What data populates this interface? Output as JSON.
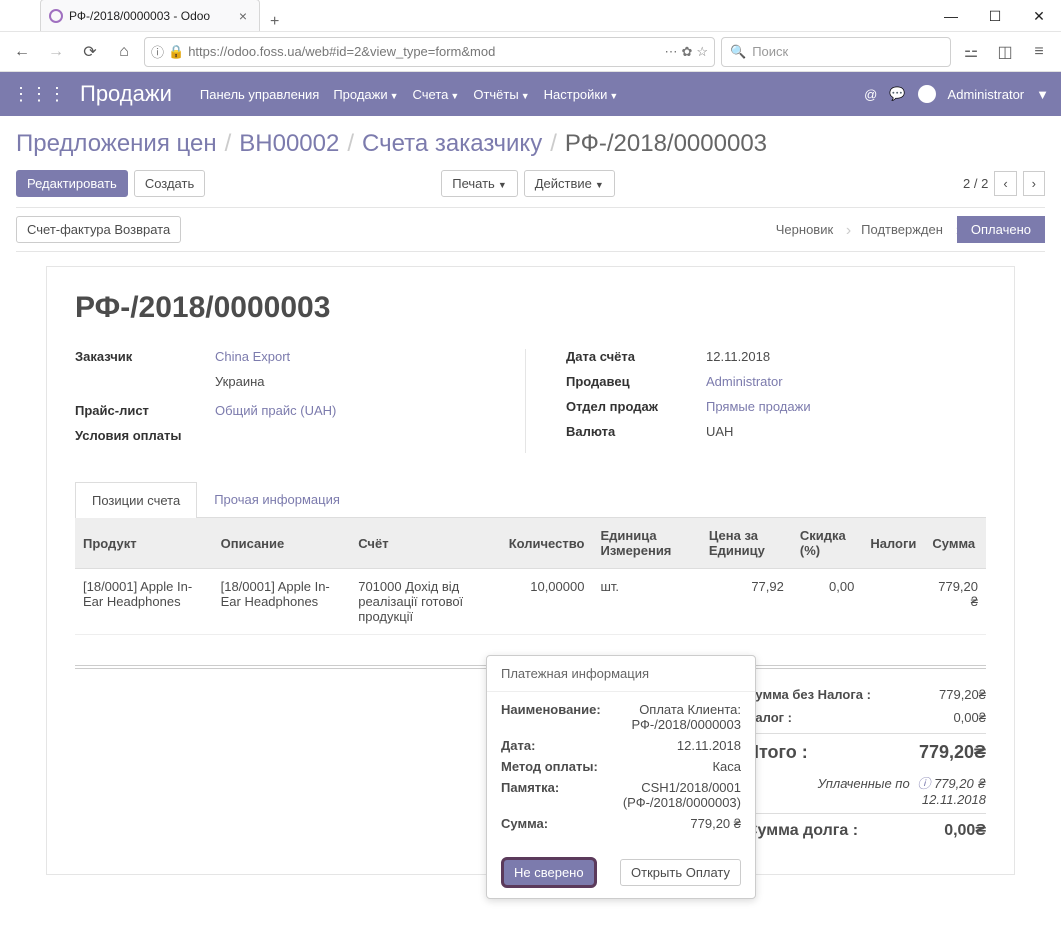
{
  "browser": {
    "tab_title": "РФ-/2018/0000003 - Odoo",
    "url": "https://odoo.foss.ua/web#id=2&view_type=form&mod",
    "search_placeholder": "Поиск"
  },
  "nav": {
    "brand": "Продажи",
    "items": [
      "Панель управления",
      "Продажи",
      "Счета",
      "Отчёты",
      "Настройки"
    ],
    "user": "Administrator"
  },
  "breadcrumb": {
    "a": "Предложения цен",
    "b": "BH00002",
    "c": "Счета заказчику",
    "current": "РФ-/2018/0000003"
  },
  "controls": {
    "edit": "Редактировать",
    "create": "Создать",
    "print": "Печать",
    "action": "Действие",
    "pager": "2 / 2"
  },
  "status": {
    "return_button": "Счет-фактура Возврата",
    "steps": [
      "Черновик",
      "Подтвержден",
      "Оплачено"
    ]
  },
  "record": {
    "title": "РФ-/2018/0000003",
    "left": {
      "customer_label": "Заказчик",
      "customer": "China Export",
      "country": "Украина",
      "pricelist_label": "Прайс-лист",
      "pricelist": "Общий прайс (UAH)",
      "terms_label": "Условия оплаты"
    },
    "right": {
      "date_label": "Дата счёта",
      "date": "12.11.2018",
      "seller_label": "Продавец",
      "seller": "Administrator",
      "team_label": "Отдел продаж",
      "team": "Прямые продажи",
      "currency_label": "Валюта",
      "currency": "UAH"
    }
  },
  "tabs": {
    "a": "Позиции счета",
    "b": "Прочая информация"
  },
  "table": {
    "headers": {
      "prod": "Продукт",
      "desc": "Описание",
      "acc": "Счёт",
      "qty": "Количество",
      "uom": "Единица Измерения",
      "price": "Цена за Единицу",
      "disc": "Скидка (%)",
      "tax": "Налоги",
      "total": "Сумма"
    },
    "row": {
      "prod": "[18/0001] Apple In-Ear Headphones",
      "desc": "[18/0001] Apple In-Ear Headphones",
      "acc": "701000 Дохід від реалізації готової продукції",
      "qty": "10,00000",
      "uom": "шт.",
      "price": "77,92",
      "disc": "0,00",
      "tax": "",
      "total": "779,20 ₴"
    }
  },
  "totals": {
    "sub_label": "Сумма без Налога :",
    "sub": "779,20₴",
    "tax_label": "Налог :",
    "tax": "0,00₴",
    "total_label": "Итого :",
    "total": "779,20₴",
    "paid_label": "Уплаченные по",
    "paid_val": "779,20 ₴",
    "paid_date": "12.11.2018",
    "debt_label": "Сумма долга :",
    "debt": "0,00₴"
  },
  "popover": {
    "title": "Платежная информация",
    "name_label": "Наименование:",
    "name": "Оплата Клиента: РФ-/2018/0000003",
    "date_label": "Дата:",
    "date": "12.11.2018",
    "method_label": "Метод оплаты:",
    "method": "Каса",
    "memo_label": "Памятка:",
    "memo": "CSH1/2018/0001 (РФ-/2018/0000003)",
    "sum_label": "Сумма:",
    "sum": "779,20 ₴",
    "unreconcile": "Не сверено",
    "open": "Открыть Оплату"
  }
}
